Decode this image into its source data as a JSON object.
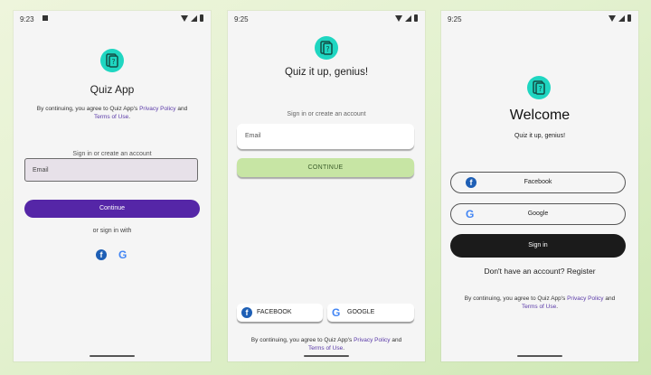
{
  "colors": {
    "logo": "#1fd6c1",
    "primary_purple": "#5526a7",
    "continue_green": "#c7e5a4",
    "signin_black": "#1b1b1b",
    "link": "#5a3aa8"
  },
  "icons": [
    "app-logo-icon",
    "facebook-icon",
    "google-icon",
    "wifi-icon",
    "signal-icon",
    "battery-icon"
  ],
  "screen1": {
    "time": "9:23",
    "app_title": "Quiz App",
    "legal_prefix": "By continuing, you agree to Quiz App's ",
    "privacy": "Privacy Policy",
    "and": " and ",
    "terms": "Terms of Use",
    "period": ".",
    "signin_prompt": "Sign in or create an account",
    "email_label": "Email",
    "continue_label": "Continue",
    "or_sign_in": "or sign in with",
    "fb_glyph": "f",
    "g_glyph": "G"
  },
  "screen2": {
    "time": "9:25",
    "title": "Quiz it up, genius!",
    "signin_prompt": "Sign in or create an account",
    "email_placeholder": "Email",
    "continue_label": "CONTINUE",
    "facebook_label": "FACEBOOK",
    "google_label": "GOOGLE",
    "legal_prefix": "By continuing, you agree to Quiz App's ",
    "privacy": "Privacy Policy",
    "and": " and ",
    "terms": "Terms of Use",
    "period": ".",
    "fb_glyph": "f",
    "g_glyph": "G"
  },
  "screen3": {
    "time": "9:25",
    "title": "Welcome",
    "subtitle": "Quiz it up, genius!",
    "facebook_label": "Facebook",
    "google_label": "Google",
    "signin_label": "Sign in",
    "register_text": "Don't have an account? Register",
    "legal_prefix": "By continuing, you agree to Quiz App's ",
    "privacy": "Privacy Policy",
    "and": " and ",
    "terms": "Terms of Use",
    "period": ".",
    "fb_glyph": "f",
    "g_glyph": "G"
  }
}
